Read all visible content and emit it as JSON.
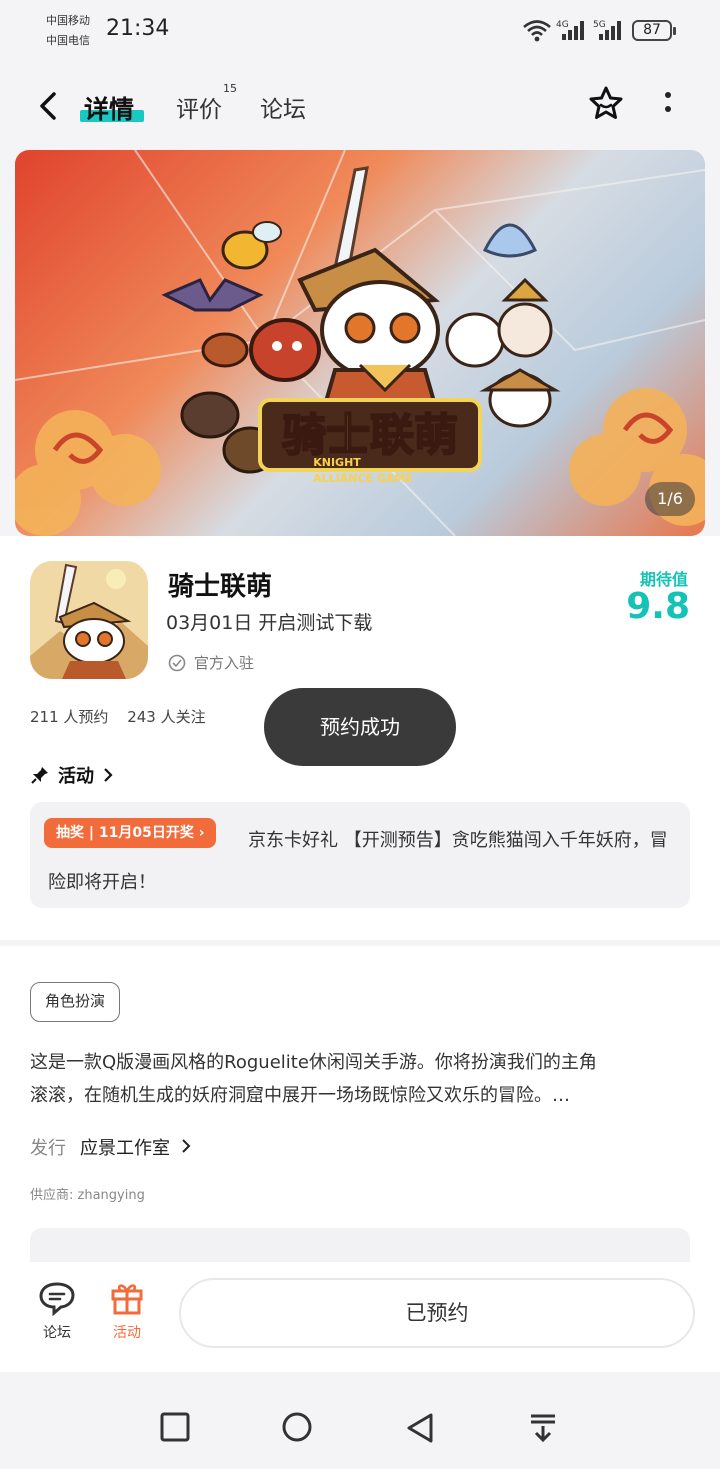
{
  "status_bar": {
    "carrier_1": "中国移动",
    "carrier_2": "中国电信",
    "time": "21:34",
    "network_1": "4G",
    "network_2": "5G",
    "battery": "87"
  },
  "header": {
    "tabs": [
      {
        "label": "详情"
      },
      {
        "label": "评价"
      },
      {
        "label": "论坛"
      }
    ],
    "review_count": "15"
  },
  "banner": {
    "title": "骑士联萌",
    "subtitle_line1": "KNIGHT",
    "subtitle_line2": "ALLIANCE GAME",
    "counter": "1/6"
  },
  "app": {
    "name": "骑士联萌",
    "release": "03月01日 开启测试下载",
    "official": "官方入驻",
    "expect_label": "期待值",
    "expect_value": "9.8",
    "reservations": "211 人预约",
    "followers": "243 人关注"
  },
  "activity": {
    "title": "活动",
    "tag": "抽奖 | 11月05日开奖",
    "text": "京东卡好礼 【开测预告】贪吃熊猫闯入千年妖府，冒险即将开启！"
  },
  "toast": "预约成功",
  "description": {
    "genre": "角色扮演",
    "text_line1": "这是一款Q版漫画风格的Roguelite休闲闯关手游。你将扮演我们的主角",
    "text_line2": "滚滚，在随机生成的妖府洞窟中展开一场场既惊险又欢乐的冒险。…",
    "publisher_label": "发行",
    "publisher": "应景工作室",
    "supplier": "供应商: zhangying"
  },
  "bottom_bar": {
    "forum": "论坛",
    "activity": "活动",
    "reserved": "已预约"
  },
  "colors": {
    "accent": "#19c8c1",
    "orange": "#f26b3a"
  }
}
